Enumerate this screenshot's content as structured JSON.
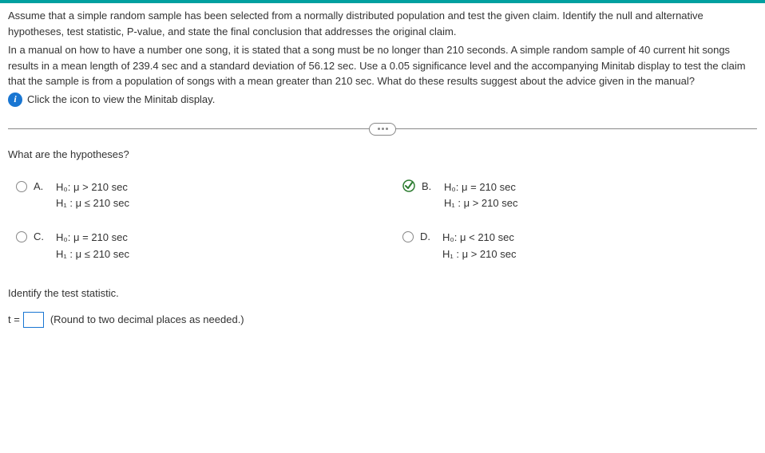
{
  "intro": "Assume that a simple random sample has been selected from a normally distributed population and test the given claim. Identify the null and alternative hypotheses, test statistic, P-value, and state the final conclusion that addresses the original claim.",
  "problem": "In a manual on how to have a number one song, it is stated that a song must be no longer than 210 seconds. A simple random sample of 40 current hit songs results in a mean length of 239.4 sec and a standard deviation of 56.12 sec. Use a 0.05 significance level and the accompanying Minitab display to test the claim that the sample is from a population of songs with a mean greater than 210 sec. What do these results suggest about the advice given in the manual?",
  "link": "Click the icon to view the Minitab display.",
  "question": "What are the hypotheses?",
  "options": {
    "A": {
      "label": "A.",
      "h0": "H₀: μ > 210 sec",
      "h1": "H₁ : μ ≤ 210 sec"
    },
    "B": {
      "label": "B.",
      "h0": "H₀: μ = 210 sec",
      "h1": "H₁ : μ > 210 sec"
    },
    "C": {
      "label": "C.",
      "h0": "H₀: μ = 210 sec",
      "h1": "H₁ : μ ≤ 210 sec"
    },
    "D": {
      "label": "D.",
      "h0": "H₀: μ < 210 sec",
      "h1": "H₁ : μ > 210 sec"
    }
  },
  "identify": "Identify the test statistic.",
  "t_prefix": "t =",
  "t_value": "",
  "t_hint": "(Round to two decimal places as needed.)"
}
